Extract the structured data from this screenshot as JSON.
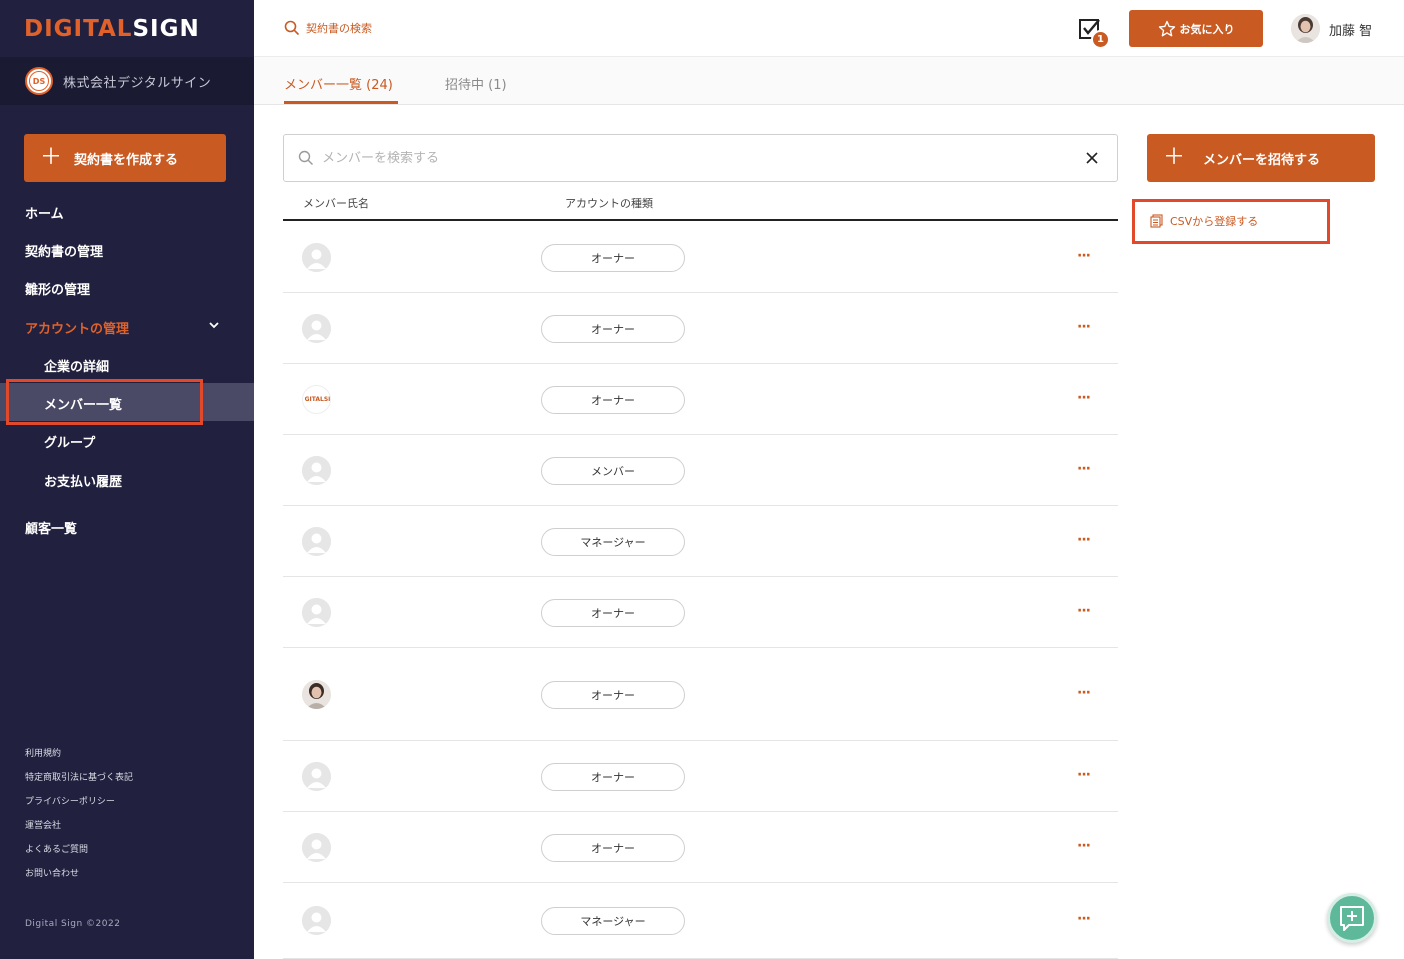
{
  "sidebar": {
    "logo_part1": "DIGITAL",
    "logo_part2": "SIGN",
    "org_initials": "DS",
    "org_name": "株式会社デジタルサイン",
    "create_button": "契約書を作成する",
    "nav": {
      "home": "ホーム",
      "contracts": "契約書の管理",
      "templates": "雛形の管理",
      "account": "アカウントの管理",
      "company": "企業の詳細",
      "members": "メンバー一覧",
      "groups": "グループ",
      "payments": "お支払い履歴",
      "customers": "顧客一覧"
    },
    "footer_links": [
      "利用規約",
      "特定商取引法に基づく表記",
      "プライバシーポリシー",
      "運営会社",
      "よくあるご質問",
      "お問い合わせ"
    ],
    "copyright": "Digital Sign ©2022"
  },
  "header": {
    "search_label": "契約書の検索",
    "task_count": "1",
    "favorites_button": "お気に入り",
    "user_name": "加藤 智"
  },
  "tabs": {
    "members": "メンバー一覧 (24)",
    "invited": "招待中 (1)"
  },
  "member_search": {
    "placeholder": "メンバーを検索する",
    "value": ""
  },
  "table": {
    "headers": {
      "name": "メンバー氏名",
      "type": "アカウントの種類"
    },
    "rows": [
      {
        "role": "オーナー",
        "avatar": "default"
      },
      {
        "role": "オーナー",
        "avatar": "default"
      },
      {
        "role": "オーナー",
        "avatar": "company-logo",
        "avatar_text": "GITALSI"
      },
      {
        "role": "メンバー",
        "avatar": "default"
      },
      {
        "role": "マネージャー",
        "avatar": "default"
      },
      {
        "role": "オーナー",
        "avatar": "default"
      },
      {
        "role": "オーナー",
        "avatar": "photo"
      },
      {
        "role": "オーナー",
        "avatar": "default"
      },
      {
        "role": "オーナー",
        "avatar": "default"
      },
      {
        "role": "マネージャー",
        "avatar": "default"
      }
    ],
    "more_label": "···"
  },
  "actions": {
    "invite_button": "メンバーを招待する",
    "csv_link": "CSVから登録する"
  },
  "colors": {
    "accent": "#c95a22",
    "sidebar_bg": "#21213f",
    "highlight_box": "#e2492a",
    "fab": "#5eb99a"
  },
  "icons": [
    "search-icon",
    "task-check-icon",
    "star-icon",
    "chevron-down-icon",
    "clear-icon",
    "plus-icon",
    "document-icon",
    "chat-plus-icon"
  ]
}
